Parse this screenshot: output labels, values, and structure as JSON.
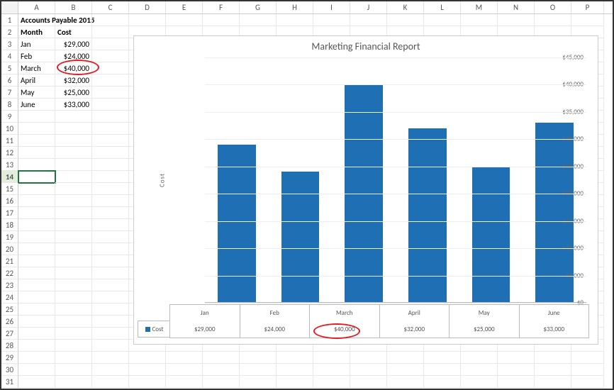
{
  "columns": [
    "A",
    "B",
    "C",
    "D",
    "E",
    "F",
    "G",
    "H",
    "I",
    "J",
    "K",
    "L",
    "M",
    "N",
    "O",
    "P"
  ],
  "title": "Accounts Payable 2015",
  "headers": {
    "month": "Month",
    "cost": "Cost"
  },
  "rows": [
    {
      "month": "Jan",
      "cost": "$29,000"
    },
    {
      "month": "Feb",
      "cost": "$24,000"
    },
    {
      "month": "March",
      "cost": "$40,000"
    },
    {
      "month": "April",
      "cost": "$32,000"
    },
    {
      "month": "May",
      "cost": "$25,000"
    },
    {
      "month": "June",
      "cost": "$33,000"
    }
  ],
  "selected_row": 14,
  "chart_data": {
    "type": "bar",
    "title": "Marketing Financial Report",
    "ylabel": "Cost",
    "xlabel": "",
    "categories": [
      "Jan",
      "Feb",
      "March",
      "April",
      "May",
      "June"
    ],
    "series": [
      {
        "name": "Cost",
        "values": [
          29000,
          24000,
          40000,
          32000,
          25000,
          33000
        ]
      }
    ],
    "ylim": [
      0,
      45000
    ],
    "y_ticks": [
      "$0",
      "$5,000",
      "$10,000",
      "$15,000",
      "$20,000",
      "$25,000",
      "$30,000",
      "$35,000",
      "$40,000",
      "$45,000"
    ],
    "data_table_values": [
      "$29,000",
      "$24,000",
      "$40,000",
      "$32,000",
      "$25,000",
      "$33,000"
    ],
    "legend_label": "Cost"
  }
}
